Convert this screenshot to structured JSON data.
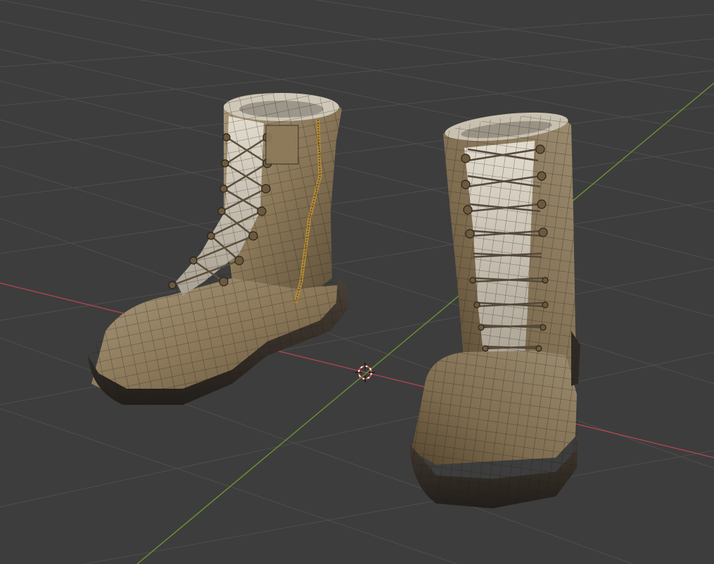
{
  "viewport": {
    "background": "#3d3d3d",
    "grid_line_color": "#4e4e4e",
    "x_axis_color": "#b5444f",
    "y_axis_color": "#6e9b2f"
  },
  "scene": {
    "objects": [
      "left-boot",
      "right-boot"
    ],
    "material_tan": "#8a7758",
    "material_light": "#c8bfae",
    "sole_color": "#2c2824",
    "wire_color": "#1a1713"
  },
  "icons": {
    "origin": "3d-cursor-icon"
  }
}
